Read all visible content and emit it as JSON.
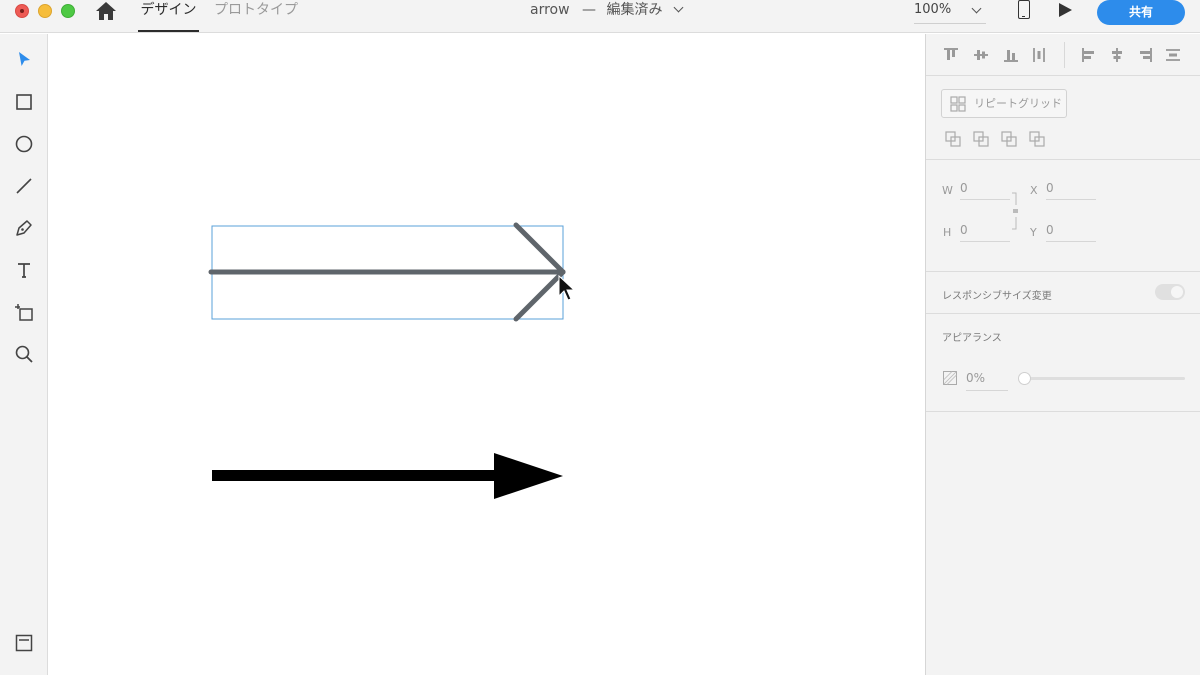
{
  "app": {
    "tabs": [
      {
        "id": "design",
        "label": "デザイン",
        "active": true
      },
      {
        "id": "prototype",
        "label": "プロトタイプ",
        "active": false
      }
    ],
    "document_title": "arrow",
    "document_separator": "—",
    "document_status": "編集済み",
    "zoom": "100%",
    "share_label": "共有",
    "accent_color": "#2d8ceb"
  },
  "toolbar": {
    "tools": [
      "select-tool",
      "rectangle-tool",
      "ellipse-tool",
      "line-tool",
      "pen-tool",
      "text-tool",
      "artboard-tool",
      "zoom-tool"
    ],
    "bottom_icon": "layers-icon"
  },
  "properties": {
    "repeat_grid_label": "リピートグリッド",
    "w_label": "W",
    "w_value": "0",
    "h_label": "H",
    "h_value": "0",
    "x_label": "X",
    "x_value": "0",
    "y_label": "Y",
    "y_value": "0",
    "responsive_label": "レスポンシブサイズ変更",
    "appearance_label": "アピアランス",
    "opacity_value": "0%",
    "opacity_fraction": 0
  },
  "canvas": {
    "selection_color": "#5aa0d8",
    "stroke_arrow_color": "#5f656b",
    "filled_arrow_color": "#000000"
  }
}
